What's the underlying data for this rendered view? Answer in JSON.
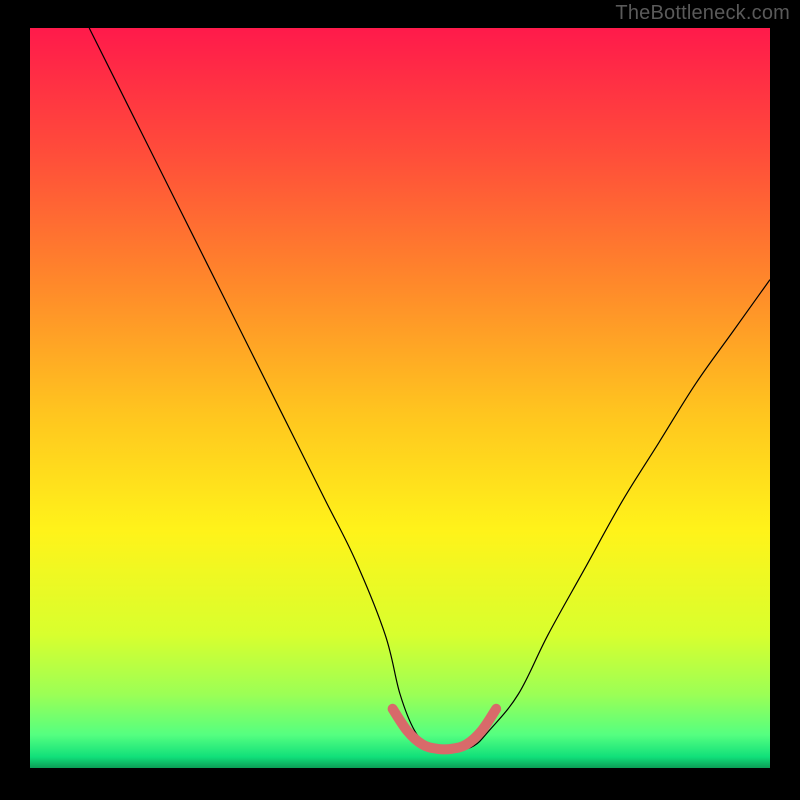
{
  "watermark": "TheBottleneck.com",
  "chart_data": {
    "type": "line",
    "title": "",
    "xlabel": "",
    "ylabel": "",
    "xlim": [
      0,
      100
    ],
    "ylim": [
      0,
      100
    ],
    "grid": false,
    "legend": null,
    "background_gradient": {
      "stops": [
        {
          "offset": 0.0,
          "color": "#ff1a4b"
        },
        {
          "offset": 0.17,
          "color": "#ff4d3a"
        },
        {
          "offset": 0.35,
          "color": "#ff8a2a"
        },
        {
          "offset": 0.52,
          "color": "#ffc51f"
        },
        {
          "offset": 0.68,
          "color": "#fff31a"
        },
        {
          "offset": 0.82,
          "color": "#d8ff2e"
        },
        {
          "offset": 0.9,
          "color": "#9cff55"
        },
        {
          "offset": 0.955,
          "color": "#55ff80"
        },
        {
          "offset": 0.985,
          "color": "#11e07a"
        },
        {
          "offset": 1.0,
          "color": "#0b9d55"
        }
      ]
    },
    "series": [
      {
        "name": "bottleneck-curve",
        "stroke": "#000000",
        "stroke_width": 1.2,
        "x": [
          8,
          12,
          16,
          20,
          24,
          28,
          32,
          36,
          40,
          44,
          48,
          50,
          52,
          54,
          56,
          58,
          60,
          62,
          66,
          70,
          75,
          80,
          85,
          90,
          95,
          100
        ],
        "y": [
          100,
          92,
          84,
          76,
          68,
          60,
          52,
          44,
          36,
          28,
          18,
          10,
          5,
          3,
          2.5,
          2.5,
          3,
          5,
          10,
          18,
          27,
          36,
          44,
          52,
          59,
          66
        ]
      },
      {
        "name": "min-bottleneck-highlight",
        "stroke": "#d86a6a",
        "stroke_width": 10,
        "linecap": "round",
        "x": [
          49,
          51,
          53,
          55,
          57,
          59,
          61,
          63
        ],
        "y": [
          8,
          5,
          3.2,
          2.6,
          2.6,
          3.2,
          5,
          8
        ]
      }
    ]
  }
}
